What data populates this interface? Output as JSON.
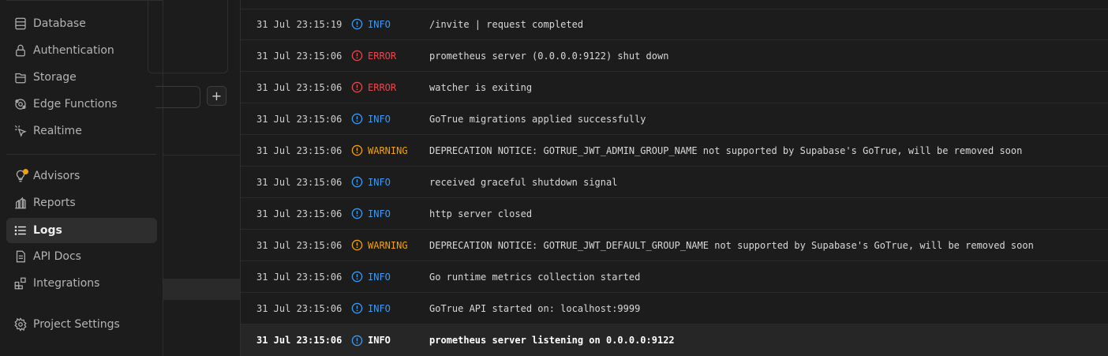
{
  "sidebar": {
    "items": [
      {
        "label": "Database",
        "icon": "database-icon"
      },
      {
        "label": "Authentication",
        "icon": "lock-icon"
      },
      {
        "label": "Storage",
        "icon": "archive-icon"
      },
      {
        "label": "Edge Functions",
        "icon": "edge-functions-icon"
      },
      {
        "label": "Realtime",
        "icon": "cursor-click-icon"
      },
      {
        "label": "Advisors",
        "icon": "lightbulb-icon"
      },
      {
        "label": "Reports",
        "icon": "chart-icon"
      },
      {
        "label": "Logs",
        "icon": "list-icon",
        "active": true
      },
      {
        "label": "API Docs",
        "icon": "file-text-icon"
      },
      {
        "label": "Integrations",
        "icon": "blocks-icon"
      },
      {
        "label": "Project Settings",
        "icon": "gear-icon"
      }
    ]
  },
  "panel": {
    "add_label": "+"
  },
  "logs": [
    {
      "timestamp": "31 Jul 23:15:19",
      "level": "INFO",
      "message": "/invite | request completed"
    },
    {
      "timestamp": "31 Jul 23:15:06",
      "level": "ERROR",
      "message": "prometheus server (0.0.0.0:9122) shut down"
    },
    {
      "timestamp": "31 Jul 23:15:06",
      "level": "ERROR",
      "message": "watcher is exiting"
    },
    {
      "timestamp": "31 Jul 23:15:06",
      "level": "INFO",
      "message": "GoTrue migrations applied successfully"
    },
    {
      "timestamp": "31 Jul 23:15:06",
      "level": "WARNING",
      "message": "DEPRECATION NOTICE: GOTRUE_JWT_ADMIN_GROUP_NAME not supported by Supabase's GoTrue, will be removed soon"
    },
    {
      "timestamp": "31 Jul 23:15:06",
      "level": "INFO",
      "message": "received graceful shutdown signal"
    },
    {
      "timestamp": "31 Jul 23:15:06",
      "level": "INFO",
      "message": "http server closed"
    },
    {
      "timestamp": "31 Jul 23:15:06",
      "level": "WARNING",
      "message": "DEPRECATION NOTICE: GOTRUE_JWT_DEFAULT_GROUP_NAME not supported by Supabase's GoTrue, will be removed soon"
    },
    {
      "timestamp": "31 Jul 23:15:06",
      "level": "INFO",
      "message": "Go runtime metrics collection started"
    },
    {
      "timestamp": "31 Jul 23:15:06",
      "level": "INFO",
      "message": "GoTrue API started on: localhost:9999"
    },
    {
      "timestamp": "31 Jul 23:15:06",
      "level": "INFO",
      "message": "prometheus server listening on 0.0.0.0:9122",
      "highlighted": true
    }
  ],
  "colors": {
    "info": "#3b9bf5",
    "error": "#e5484d",
    "warning": "#f1a10d",
    "accent_dot": "#f1a10d"
  }
}
